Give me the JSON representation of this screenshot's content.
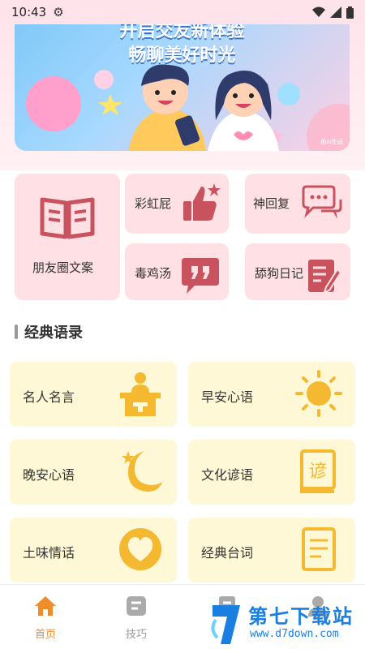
{
  "status": {
    "time": "10:43"
  },
  "banner": {
    "line1": "开启交友新体验",
    "line2": "畅聊美好时光",
    "mark": "由AI生成"
  },
  "tiles": {
    "friends_circle": "朋友圈文案",
    "rainbow_fart": "彩虹屁",
    "god_reply": "神回复",
    "poison_soup": "毒鸡汤",
    "dog_diary": "舔狗日记"
  },
  "section": {
    "title": "经典语录"
  },
  "cards": [
    {
      "label": "名人名言",
      "icon": "podium-icon"
    },
    {
      "label": "早安心语",
      "icon": "sun-icon"
    },
    {
      "label": "晚安心语",
      "icon": "moon-icon"
    },
    {
      "label": "文化谚语",
      "icon": "book-icon"
    },
    {
      "label": "土味情话",
      "icon": "heart-icon"
    },
    {
      "label": "经典台词",
      "icon": "script-icon"
    }
  ],
  "tabs": [
    {
      "label": "首页",
      "icon": "home-icon",
      "active": true
    },
    {
      "label": "技巧",
      "icon": "tips-icon",
      "active": false
    },
    {
      "label": "",
      "icon": "doc-icon",
      "active": false
    },
    {
      "label": "",
      "icon": "user-icon",
      "active": false
    }
  ],
  "watermark": {
    "cn": "第七下载站",
    "en": "www.d7down.com"
  },
  "colors": {
    "accent": "#f08c2a",
    "tile_bg": "#ffe1e5",
    "card_bg": "#fff8d6",
    "icon_red": "#c9525f",
    "icon_yellow": "#f5b931"
  }
}
